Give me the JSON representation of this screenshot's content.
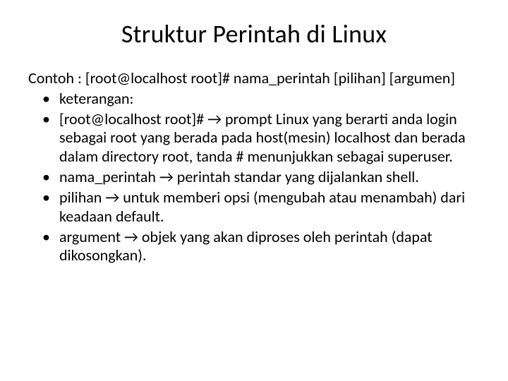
{
  "title": "Struktur Perintah di Linux",
  "lead": "Contoh : [root@localhost root]# nama_perintah [pilihan] [argumen]",
  "bullets": [
    "keterangan:",
    "[root@localhost root]# → prompt Linux yang berarti anda login sebagai root yang berada pada host(mesin) localhost dan berada dalam directory root, tanda # menunjukkan sebagai superuser.",
    "nama_perintah → perintah standar yang dijalankan shell.",
    "pilihan → untuk memberi opsi (mengubah atau menambah) dari keadaan default.",
    "argument → objek yang akan diproses oleh perintah (dapat dikosongkan)."
  ]
}
